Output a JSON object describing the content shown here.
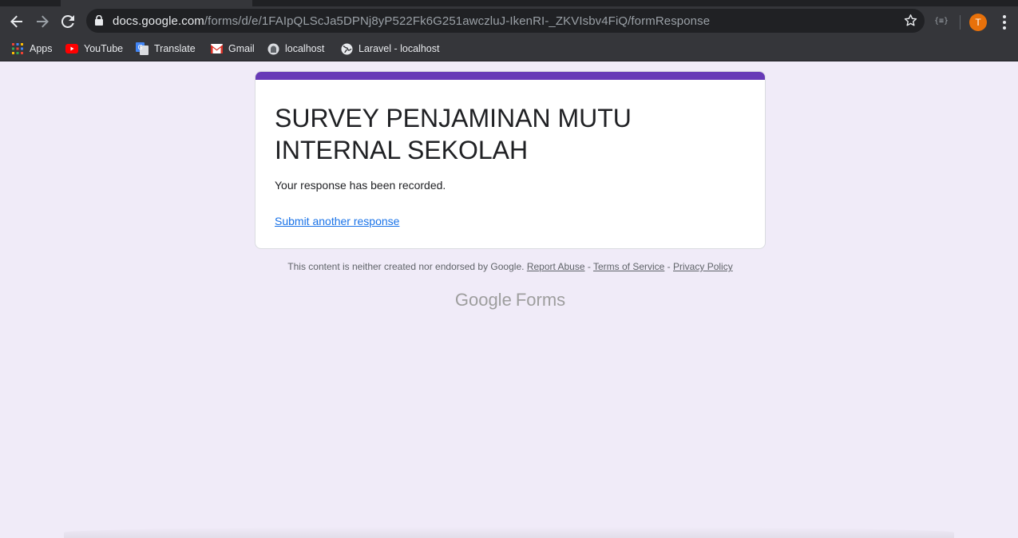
{
  "browser": {
    "url_host": "docs.google.com",
    "url_path": "/forms/d/e/1FAIpQLScJa5DPNj8yP522Fk6G251awczluJ-IkenRI-_ZKVIsbv4FiQ/formResponse",
    "extension_label": "{≡}",
    "avatar_initial": "T"
  },
  "bookmarks": [
    {
      "label": "Apps",
      "icon": "apps-grid-icon"
    },
    {
      "label": "YouTube",
      "icon": "youtube-icon"
    },
    {
      "label": "Translate",
      "icon": "translate-icon"
    },
    {
      "label": "Gmail",
      "icon": "gmail-icon"
    },
    {
      "label": "localhost",
      "icon": "localhost-icon"
    },
    {
      "label": "Laravel - localhost",
      "icon": "globe-icon"
    }
  ],
  "form": {
    "title": "SURVEY PENJAMINAN MUTU INTERNAL SEKOLAH",
    "confirmation": "Your response has been recorded.",
    "submit_another": "Submit another response",
    "accent_color": "#673ab7"
  },
  "footer": {
    "disclaimer": "This content is neither created nor endorsed by Google.",
    "report_abuse": "Report Abuse",
    "terms": "Terms of Service",
    "privacy": "Privacy Policy",
    "separator": " - ",
    "brand_google": "Google",
    "brand_forms": "Forms"
  }
}
